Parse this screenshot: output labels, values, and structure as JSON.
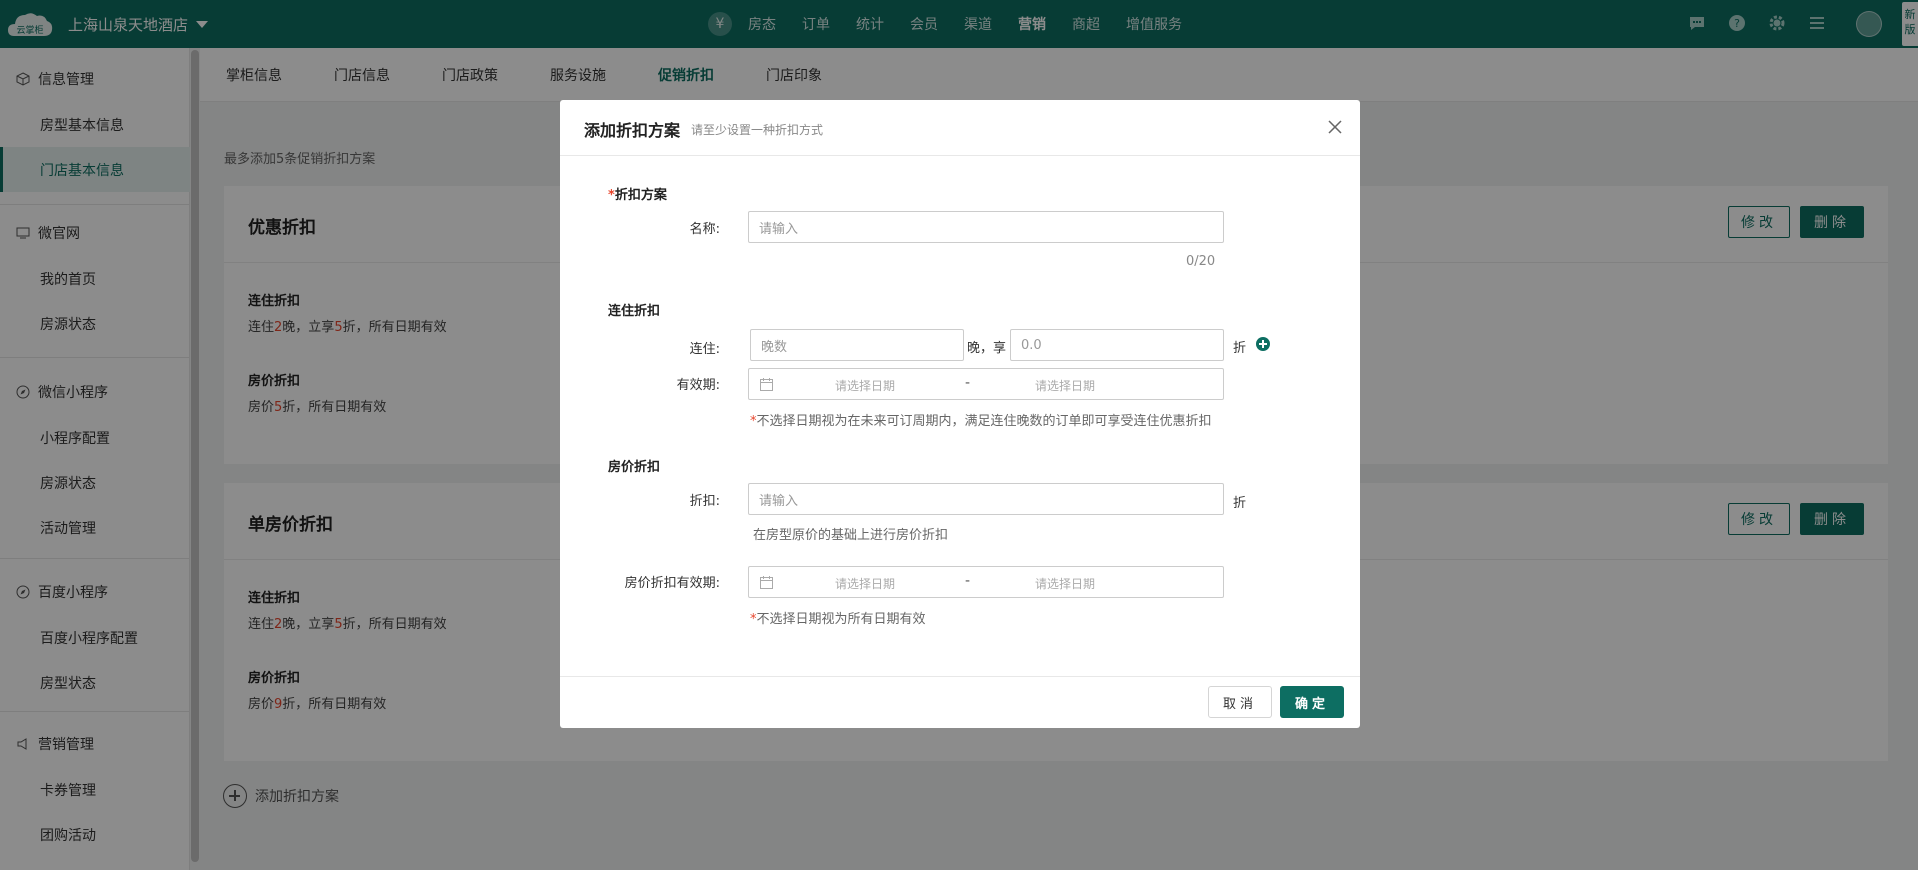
{
  "colors": {
    "brand": "#0d6e62",
    "accent_red": "#e8462d"
  },
  "topbar": {
    "logo_text": "云掌柜",
    "hotel_name": "上海山泉天地酒店",
    "currency_icon": "yen-icon",
    "nav": [
      "房态",
      "订单",
      "统计",
      "会员",
      "渠道",
      "营销",
      "商超",
      "增值服务"
    ],
    "active_nav": "营销",
    "new_version": "新版"
  },
  "sidebar": {
    "groups": [
      {
        "title": "信息管理",
        "icon": "cube-icon",
        "items": [
          "房型基本信息",
          "门店基本信息"
        ]
      },
      {
        "title": "微官网",
        "icon": "monitor-icon",
        "items": [
          "我的首页",
          "房源状态"
        ]
      },
      {
        "title": "微信小程序",
        "icon": "compass-icon",
        "items": [
          "小程序配置",
          "房源状态",
          "活动管理"
        ]
      },
      {
        "title": "百度小程序",
        "icon": "compass-icon",
        "items": [
          "百度小程序配置",
          "房型状态"
        ]
      },
      {
        "title": "营销管理",
        "icon": "megaphone-icon",
        "items": [
          "卡券管理",
          "团购活动"
        ]
      }
    ],
    "active_item": "门店基本信息"
  },
  "tabs": [
    "掌柜信息",
    "门店信息",
    "门店政策",
    "服务设施",
    "促销折扣",
    "门店印象"
  ],
  "active_tab": "促销折扣",
  "main": {
    "hint": "最多添加5条促销折扣方案",
    "edit_label": "修改",
    "delete_label": "删除",
    "cards": [
      {
        "title": "优惠折扣",
        "stay": {
          "title": "连住折扣",
          "p1": "连住",
          "nights": "2",
          "p2": "晚，立享",
          "rate": "5",
          "p3": "折，所有日期有效"
        },
        "price": {
          "title": "房价折扣",
          "p1": "房价",
          "rate": "5",
          "p2": "折，所有日期有效"
        }
      },
      {
        "title": "单房价折扣",
        "stay": {
          "title": "连住折扣",
          "p1": "连住",
          "nights": "2",
          "p2": "晚，立享",
          "rate": "5",
          "p3": "折，所有日期有效"
        },
        "price": {
          "title": "房价折扣",
          "p1": "房价",
          "rate": "9",
          "p2": "折，所有日期有效"
        }
      }
    ],
    "add_plan": "添加折扣方案"
  },
  "modal": {
    "title": "添加折扣方案",
    "subtitle": "请至少设置一种折扣方式",
    "plan_section": "折扣方案",
    "required_mark": "*",
    "name_label": "名称:",
    "name_placeholder": "请输入",
    "name_count": "0/20",
    "stay_section": "连住折扣",
    "stay_label": "连住:",
    "nights_placeholder": "晚数",
    "nights_unit": "晚，享",
    "rate_placeholder": "0.0",
    "discount_unit": "折",
    "validity_label": "有效期:",
    "date_from": "请选择日期",
    "date_sep": "-",
    "date_to": "请选择日期",
    "stay_note": "不选择日期视为在未来可订周期内，满足连住晚数的订单即可享受连住优惠折扣",
    "price_section": "房价折扣",
    "price_label": "折扣:",
    "price_placeholder": "请输入",
    "price_note": "在房型原价的基础上进行房价折扣",
    "price_validity_label": "房价折扣有效期:",
    "price_validity_note": "不选择日期视为所有日期有效",
    "cancel_label": "取消",
    "ok_label": "确定"
  }
}
